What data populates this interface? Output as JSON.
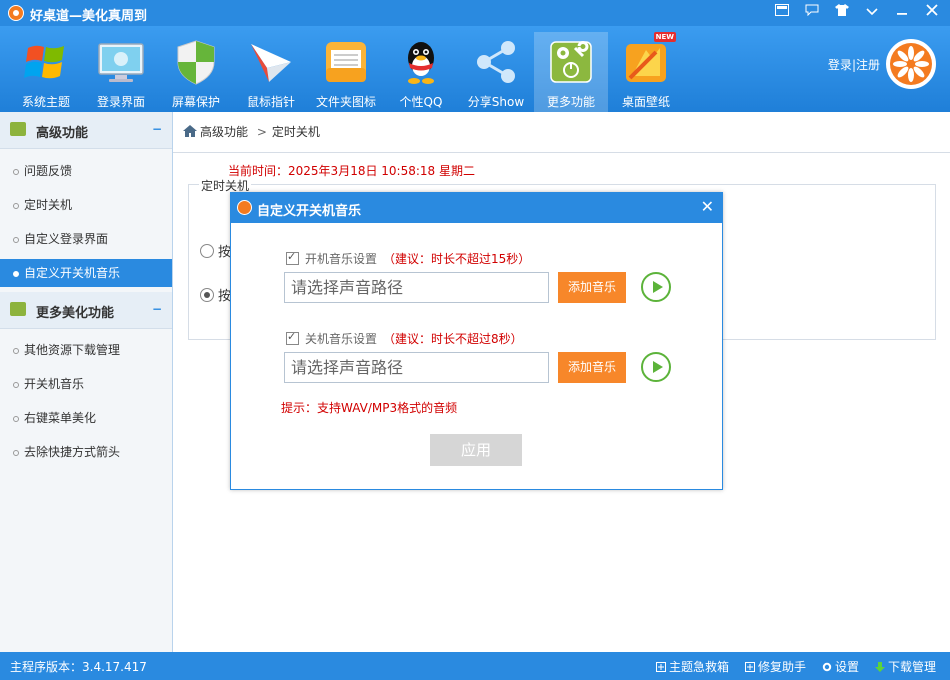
{
  "app": {
    "title": "好桌道—美化真周到"
  },
  "window_controls": [
    "skin-icon",
    "message-icon",
    "shirt-icon",
    "menu-icon",
    "minimize-icon",
    "close-icon"
  ],
  "toolbar": {
    "items": [
      {
        "label": "系统主题",
        "icon": "windows-logo-icon"
      },
      {
        "label": "登录界面",
        "icon": "monitor-icon"
      },
      {
        "label": "屏幕保护",
        "icon": "shield-icon"
      },
      {
        "label": "鼠标指针",
        "icon": "paper-plane-icon"
      },
      {
        "label": "文件夹图标",
        "icon": "folder-icon"
      },
      {
        "label": "个性QQ",
        "icon": "qq-penguin-icon"
      },
      {
        "label": "分享Show",
        "icon": "share-icon"
      },
      {
        "label": "更多功能",
        "icon": "tools-icon"
      },
      {
        "label": "桌面壁纸",
        "icon": "wallpaper-icon",
        "badge": "NEW"
      }
    ],
    "active_index": 7
  },
  "auth": {
    "login": "登录",
    "separator": "|",
    "register": "注册"
  },
  "sidebar": {
    "groups": [
      {
        "title": "高级功能",
        "collapse": "−",
        "items": [
          "问题反馈",
          "定时关机",
          "自定义登录界面",
          "自定义开关机音乐"
        ]
      },
      {
        "title": "更多美化功能",
        "collapse": "−",
        "items": [
          "其他资源下载管理",
          "开关机音乐",
          "右键菜单美化",
          "去除快捷方式箭头"
        ]
      }
    ],
    "active": "自定义开关机音乐"
  },
  "breadcrumb": {
    "root": "高级功能",
    "separator": ">",
    "current": "定时关机"
  },
  "main": {
    "current_time_label": "当前时间：",
    "current_time_value": "2025年3月18日  10:58:18  星期二",
    "section_title": "定时关机",
    "radio1_label": "按",
    "radio2_label": "按"
  },
  "dialog": {
    "title": "自定义开关机音乐",
    "close": "✕",
    "startup": {
      "checkbox_label": "开机音乐设置",
      "hint": "（建议：时长不超过15秒）",
      "placeholder": "请选择声音路径",
      "add_button": "添加音乐"
    },
    "shutdown": {
      "checkbox_label": "关机音乐设置",
      "hint": "（建议：时长不超过8秒）",
      "placeholder": "请选择声音路径",
      "add_button": "添加音乐"
    },
    "tip": "提示：支持WAV/MP3格式的音频",
    "apply": "应用"
  },
  "status": {
    "version_label": "主程序版本：",
    "version": "3.4.17.417",
    "links": [
      "主题急救箱",
      "修复助手",
      "设置",
      "下载管理"
    ]
  },
  "colors": {
    "primary_blue": "#2a8ae0",
    "accent_orange": "#f7872a",
    "alert_red": "#d10000",
    "play_green": "#5cb33a"
  }
}
